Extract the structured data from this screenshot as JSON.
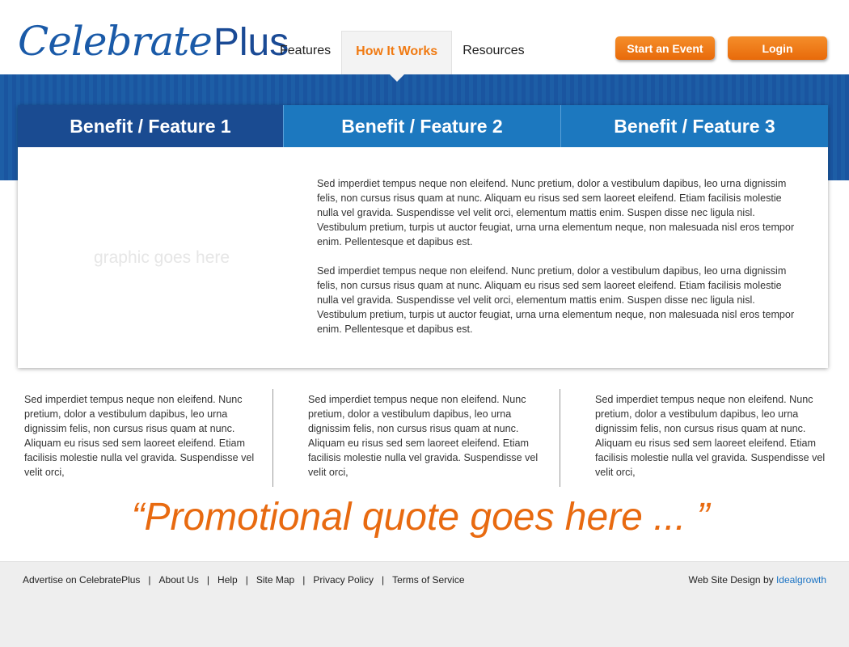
{
  "brand": {
    "logo_script": "Celebrate",
    "logo_plus": "Plus"
  },
  "nav": [
    {
      "label": "Features",
      "active": false
    },
    {
      "label": "How It Works",
      "active": true
    },
    {
      "label": "Resources",
      "active": false
    }
  ],
  "buttons": {
    "start": "Start an Event",
    "login": "Login"
  },
  "tabs": [
    "Benefit / Feature 1",
    "Benefit / Feature 2",
    "Benefit / Feature 3"
  ],
  "panel": {
    "graphic_placeholder": "graphic goes here",
    "paragraphs": [
      "Sed imperdiet tempus neque non eleifend. Nunc pretium, dolor a vestibulum dapibus, leo urna dignissim felis, non cursus risus quam at nunc. Aliquam eu risus sed sem laoreet eleifend. Etiam facilisis molestie nulla vel gravida. Suspendisse vel velit orci, elementum mattis enim. Suspen disse nec ligula nisl. Vestibulum pretium, turpis ut auctor feugiat, urna urna elementum neque, non malesuada nisl eros tempor enim. Pellentesque et dapibus est.",
      "Sed imperdiet tempus neque non eleifend. Nunc pretium, dolor a vestibulum dapibus, leo urna dignissim felis, non cursus risus quam at nunc. Aliquam eu risus sed sem laoreet eleifend. Etiam facilisis molestie nulla vel gravida. Suspendisse vel velit orci, elementum mattis enim. Suspen disse nec ligula nisl. Vestibulum pretium, turpis ut auctor feugiat, urna urna elementum neque, non malesuada nisl eros tempor enim. Pellentesque et dapibus est."
    ]
  },
  "columns": [
    "Sed imperdiet tempus neque non eleifend. Nunc pretium, dolor a vestibulum dapibus, leo urna dignissim felis, non cursus risus quam at nunc. Aliquam eu risus sed sem laoreet eleifend. Etiam facilisis molestie nulla vel gravida. Suspendisse vel velit orci,",
    "Sed imperdiet tempus neque non eleifend. Nunc pretium, dolor a vestibulum dapibus, leo urna dignissim felis, non cursus risus quam at nunc. Aliquam eu risus sed sem laoreet eleifend. Etiam facilisis molestie nulla vel gravida. Suspendisse vel velit orci,",
    "Sed imperdiet tempus neque non eleifend. Nunc pretium, dolor a vestibulum dapibus, leo urna dignissim felis, non cursus risus quam at nunc. Aliquam eu risus sed sem laoreet eleifend. Etiam facilisis molestie nulla vel gravida. Suspendisse vel velit orci,"
  ],
  "quote": "“Promotional quote goes here ... ”",
  "footer": {
    "links": [
      "Advertise on CelebratePlus",
      "About Us",
      "Help",
      "Site Map",
      "Privacy Policy",
      "Terms of Service"
    ],
    "separator": "|",
    "credit_prefix": "Web Site Design by ",
    "credit_link": "Idealgrowth"
  },
  "colors": {
    "brand_blue": "#1a5aa8",
    "accent_orange": "#e86a0a",
    "tab_dark": "#1a4b91",
    "tab_light": "#1c78bf"
  }
}
